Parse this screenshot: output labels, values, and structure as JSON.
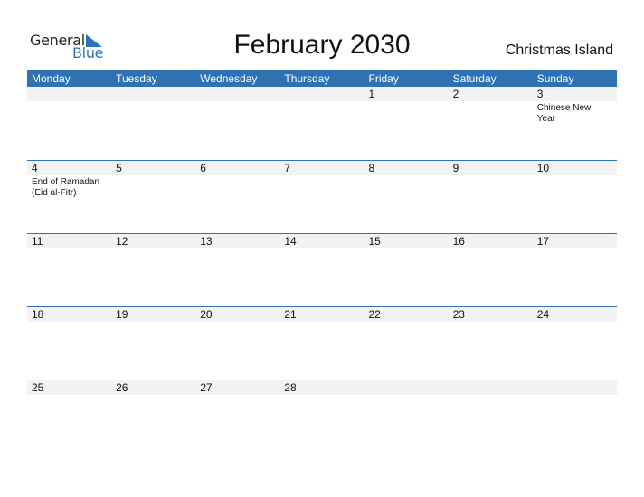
{
  "logo": {
    "word1": "General",
    "word2": "Blue"
  },
  "header": {
    "title": "February 2030",
    "region": "Christmas Island"
  },
  "colors": {
    "accent": "#2e72b3",
    "strip": "#f2f2f2"
  },
  "weekdays": [
    "Monday",
    "Tuesday",
    "Wednesday",
    "Thursday",
    "Friday",
    "Saturday",
    "Sunday"
  ],
  "weeks": [
    [
      {
        "day": "",
        "event": ""
      },
      {
        "day": "",
        "event": ""
      },
      {
        "day": "",
        "event": ""
      },
      {
        "day": "",
        "event": ""
      },
      {
        "day": "1",
        "event": ""
      },
      {
        "day": "2",
        "event": ""
      },
      {
        "day": "3",
        "event": "Chinese New Year"
      }
    ],
    [
      {
        "day": "4",
        "event": "End of Ramadan (Eid al-Fitr)"
      },
      {
        "day": "5",
        "event": ""
      },
      {
        "day": "6",
        "event": ""
      },
      {
        "day": "7",
        "event": ""
      },
      {
        "day": "8",
        "event": ""
      },
      {
        "day": "9",
        "event": ""
      },
      {
        "day": "10",
        "event": ""
      }
    ],
    [
      {
        "day": "11",
        "event": ""
      },
      {
        "day": "12",
        "event": ""
      },
      {
        "day": "13",
        "event": ""
      },
      {
        "day": "14",
        "event": ""
      },
      {
        "day": "15",
        "event": ""
      },
      {
        "day": "16",
        "event": ""
      },
      {
        "day": "17",
        "event": ""
      }
    ],
    [
      {
        "day": "18",
        "event": ""
      },
      {
        "day": "19",
        "event": ""
      },
      {
        "day": "20",
        "event": ""
      },
      {
        "day": "21",
        "event": ""
      },
      {
        "day": "22",
        "event": ""
      },
      {
        "day": "23",
        "event": ""
      },
      {
        "day": "24",
        "event": ""
      }
    ],
    [
      {
        "day": "25",
        "event": ""
      },
      {
        "day": "26",
        "event": ""
      },
      {
        "day": "27",
        "event": ""
      },
      {
        "day": "28",
        "event": ""
      },
      {
        "day": "",
        "event": ""
      },
      {
        "day": "",
        "event": ""
      },
      {
        "day": "",
        "event": ""
      }
    ]
  ]
}
